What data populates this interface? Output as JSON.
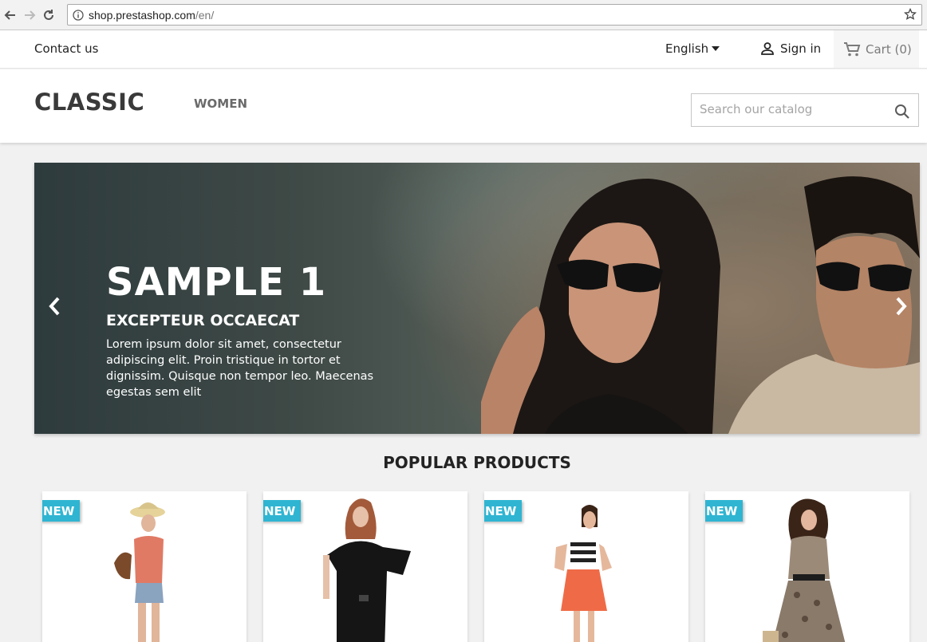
{
  "browser": {
    "url_host": "shop.prestashop.com",
    "url_path": "/en/"
  },
  "topnav": {
    "contact": "Contact us",
    "language": "English",
    "signin": "Sign in",
    "cart": "Cart (0)"
  },
  "header": {
    "logo": "CLASSIC",
    "menu": [
      {
        "label": "WOMEN"
      }
    ],
    "search_placeholder": "Search our catalog"
  },
  "carousel": {
    "title": "SAMPLE 1",
    "subtitle": "EXCEPTEUR OCCAECAT",
    "text": "Lorem ipsum dolor sit amet, consectetur adipiscing elit. Proin tristique in tortor et dignissim. Quisque non tempor leo. Maecenas egestas sem elit"
  },
  "popular": {
    "title": "POPULAR PRODUCTS",
    "products": [
      {
        "badge": "NEW"
      },
      {
        "badge": "NEW"
      },
      {
        "badge": "NEW"
      },
      {
        "badge": "NEW"
      }
    ]
  },
  "colors": {
    "badge": "#2fb5d2",
    "text": "#232323"
  }
}
